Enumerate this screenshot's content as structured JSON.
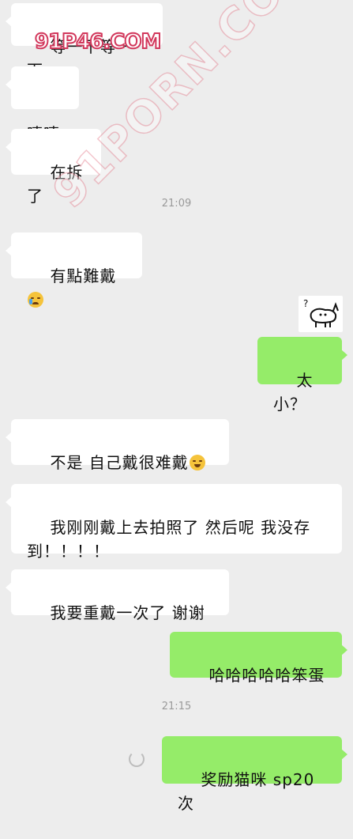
{
  "messages": [
    {
      "text": "等一下等一下"
    },
    {
      "text": "嘻嘻"
    },
    {
      "text": "在拆了"
    },
    {
      "time": "21:09"
    },
    {
      "text": "有點難戴"
    },
    {
      "text": "太小？"
    },
    {
      "text": "不是 自己戴很难戴"
    },
    {
      "text": "我刚刚戴上去拍照了 然后呢 我没存到！！！！"
    },
    {
      "text": "我要重戴一次了 谢谢"
    },
    {
      "text": "哈哈哈哈哈笨蛋"
    },
    {
      "time": "21:15"
    },
    {
      "text": "奖励猫咪 sp20 次"
    }
  ],
  "sticker": {
    "question": "?"
  },
  "watermarks": {
    "top": "91P46.COM",
    "diagonal": "91PORN.COM"
  },
  "colors": {
    "background": "#ededed",
    "incoming_bubble": "#ffffff",
    "outgoing_bubble": "#95ec69",
    "timestamp": "#9a9a9a",
    "watermark": "#d2385c"
  },
  "icons": {
    "cry_emoji": "crying-face",
    "laugh_emoji": "rolling-laughing-face",
    "sending": "loading-spinner"
  }
}
